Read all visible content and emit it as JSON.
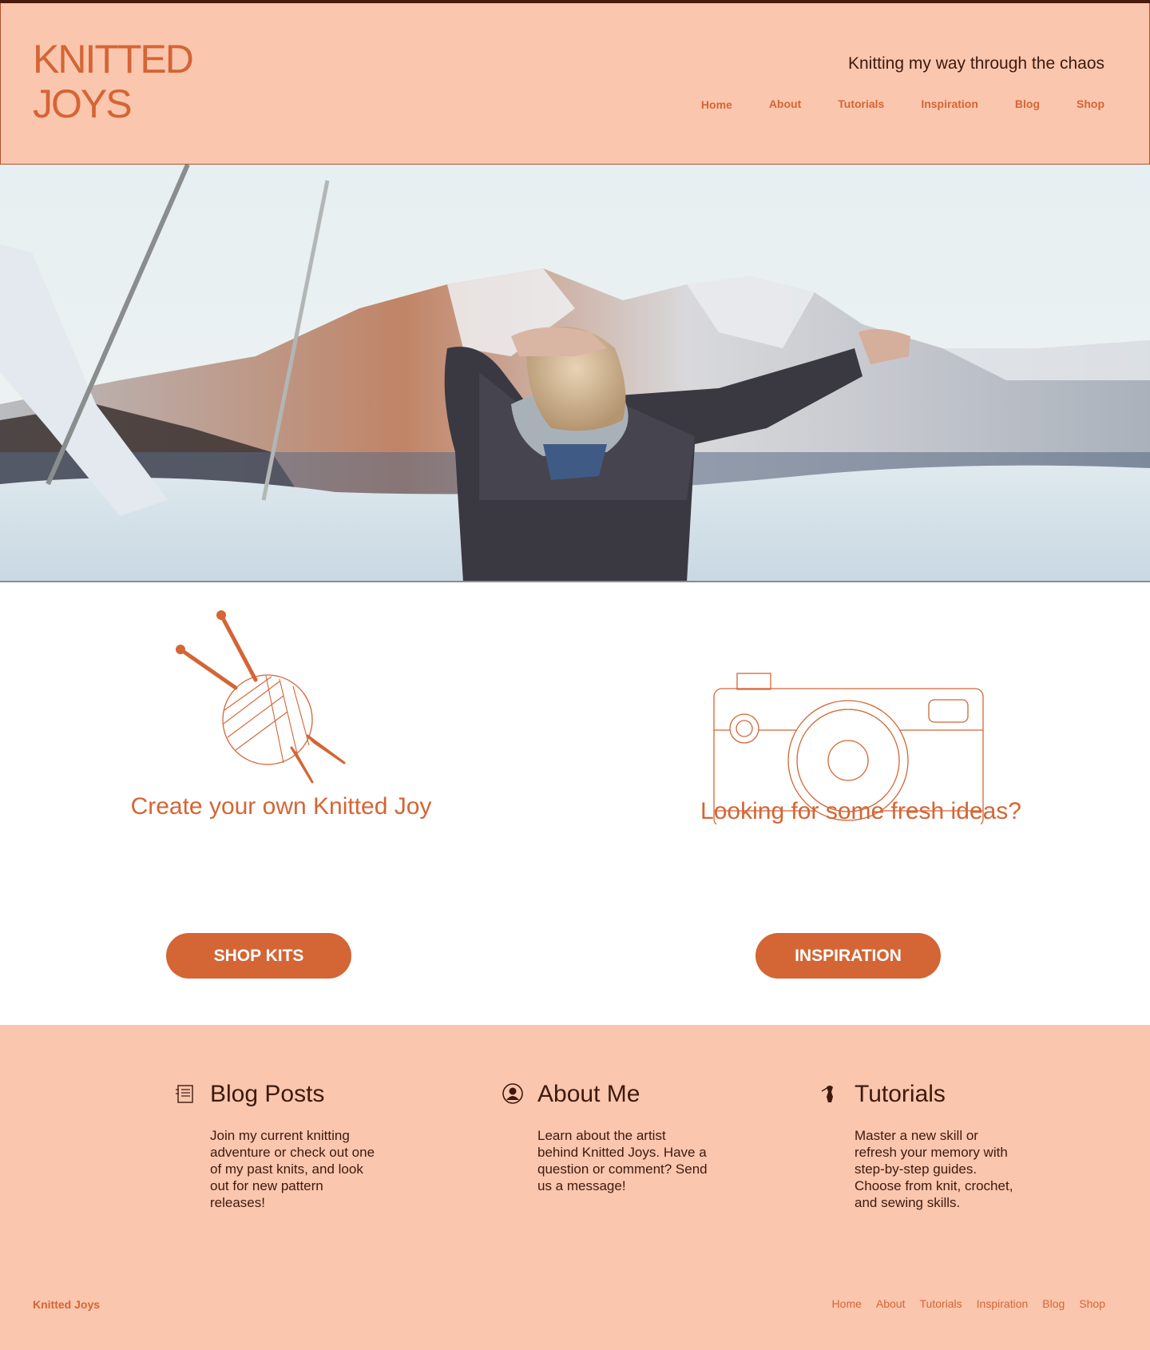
{
  "header": {
    "logo_line1": "KNITTED",
    "logo_line2": "JOYS",
    "tagline": "Knitting my way through the chaos",
    "nav": [
      "Home",
      "About",
      "Tutorials",
      "Inspiration",
      "Blog",
      "Shop"
    ]
  },
  "features": {
    "left": {
      "title": "Create your own Knitted Joy",
      "button": "SHOP KITS",
      "icon": "yarn-ball-needles-icon"
    },
    "right": {
      "title": "Looking for some fresh ideas?",
      "button": "INSPIRATION",
      "icon": "camera-icon"
    }
  },
  "columns": [
    {
      "icon": "notebook-icon",
      "title": "Blog Posts",
      "text": "Join my current knitting adventure or check out one of my past knits, and look out for new pattern releases!"
    },
    {
      "icon": "user-icon",
      "title": "About Me",
      "text": "Learn about the artist behind Knitted Joys. Have a question or comment? Send us a message!"
    },
    {
      "icon": "dress-form-icon",
      "title": "Tutorials",
      "text": "Master a new skill or refresh your memory with step-by-step guides. Choose from knit, crochet, and sewing skills."
    }
  ],
  "footer": {
    "brand": "Knitted Joys",
    "nav": [
      "Home",
      "About",
      "Tutorials",
      "Inspiration",
      "Blog",
      "Shop"
    ]
  },
  "colors": {
    "accent": "#d46535",
    "peach": "#fbc6ae",
    "dark": "#3d1a0e"
  }
}
